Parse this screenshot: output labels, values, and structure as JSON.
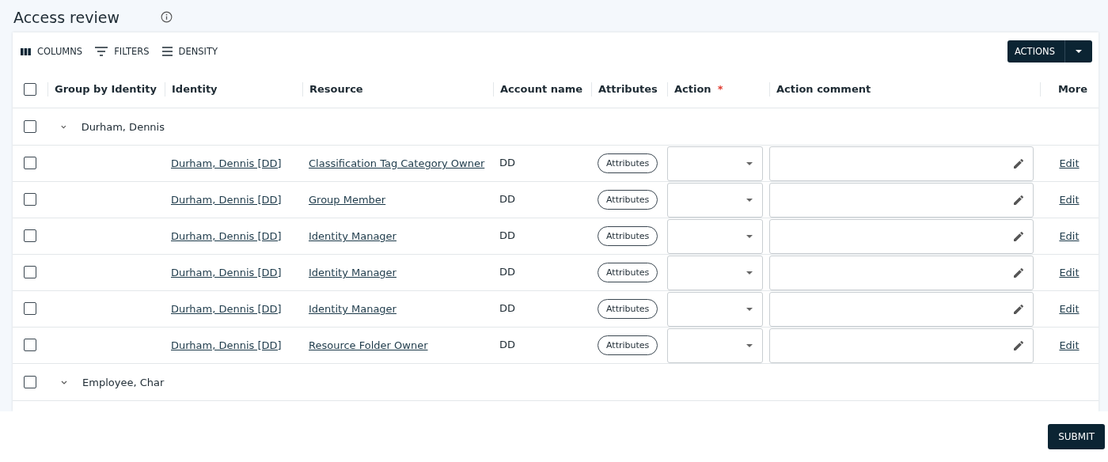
{
  "title": "Access review",
  "toolbar": [
    {
      "label": "COLUMNS",
      "kind": "columns"
    },
    {
      "label": "FILTERS",
      "kind": "filters"
    },
    {
      "label": "DENSITY",
      "kind": "density"
    }
  ],
  "actions_button": "ACTIONS",
  "select_all": {
    "checked": false
  },
  "columns": [
    {
      "label": "Group by Identity"
    },
    {
      "label": "Identity"
    },
    {
      "label": "Resource"
    },
    {
      "label": "Account name"
    },
    {
      "label": "Attributes"
    },
    {
      "label": "Action",
      "required_mark": "*"
    },
    {
      "label": "Action comment"
    },
    {
      "label": "More"
    }
  ],
  "groups": [
    {
      "name": "Durham, Dennis",
      "expanded": true,
      "checked": false,
      "rows": [
        {
          "checked": false,
          "identity": "Durham, Dennis [DD]",
          "resource": "Classification Tag Category Owner",
          "account": "DD",
          "attributes": "Attributes",
          "more": "Edit"
        },
        {
          "checked": false,
          "identity": "Durham, Dennis [DD]",
          "resource": "Group Member",
          "account": "DD",
          "attributes": "Attributes",
          "more": "Edit"
        },
        {
          "checked": false,
          "identity": "Durham, Dennis [DD]",
          "resource": "Identity Manager",
          "account": "DD",
          "attributes": "Attributes",
          "more": "Edit"
        },
        {
          "checked": false,
          "identity": "Durham, Dennis [DD]",
          "resource": "Identity Manager",
          "account": "DD",
          "attributes": "Attributes",
          "more": "Edit"
        },
        {
          "checked": false,
          "identity": "Durham, Dennis [DD]",
          "resource": "Identity Manager",
          "account": "DD",
          "attributes": "Attributes",
          "more": "Edit"
        },
        {
          "checked": false,
          "identity": "Durham, Dennis [DD]",
          "resource": "Resource Folder Owner",
          "account": "DD",
          "attributes": "Attributes",
          "more": "Edit"
        }
      ]
    },
    {
      "name": "Employee, Char",
      "expanded": true,
      "checked": false
    }
  ],
  "submit": "SUBMIT"
}
